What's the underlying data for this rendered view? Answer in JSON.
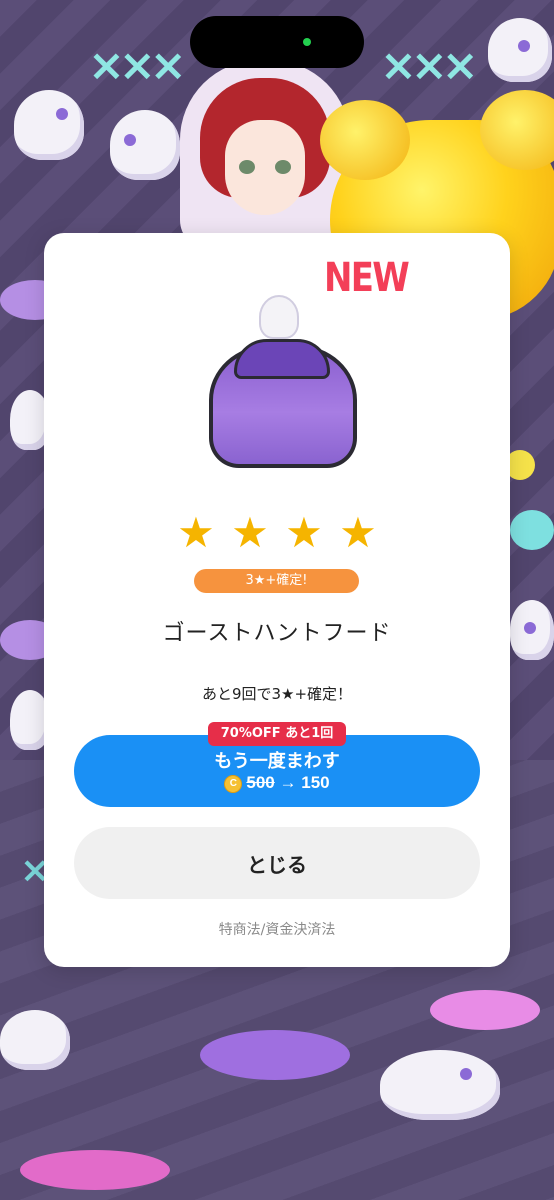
{
  "modal": {
    "badge": "NEW",
    "guarantee_pill": "3★+確定!",
    "item_name": "ゴーストハントフード",
    "rating_stars": 4,
    "pity_text": "あと9回で3★+確定！",
    "discount_badge": "70%OFF あと1回",
    "spin_label": "もう一度まわす",
    "coin_glyph": "C",
    "price_old": "500",
    "price_arrow": "→",
    "price_new": "150",
    "close_label": "とじる",
    "legal_link": "特商法/資金決済法"
  },
  "colors": {
    "spin_button": "#1a90f5",
    "discount_badge": "#e62e49",
    "guarantee_pill": "#f6933e",
    "star": "#f5b400",
    "new_badge": "#f33f58"
  }
}
